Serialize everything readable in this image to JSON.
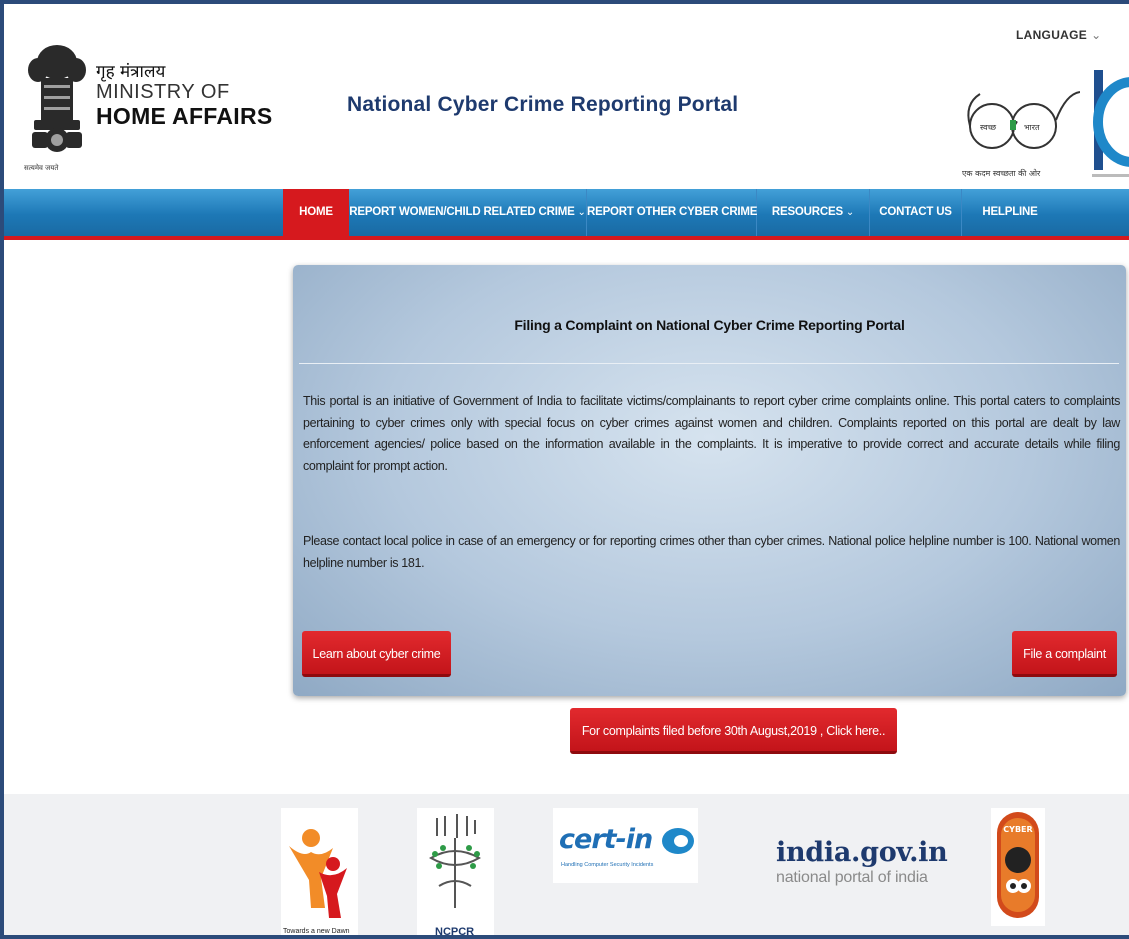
{
  "header": {
    "ministry_hindi": "गृह मंत्रालय",
    "ministry_line1": "MINISTRY OF",
    "ministry_line2": "HOME AFFAIRS",
    "emblem_caption": "सत्यमेव जयते",
    "portal_title": "National Cyber Crime Reporting Portal",
    "language_label": "LANGUAGE",
    "swachh_left": "स्वच्छ",
    "swachh_right": "भारत",
    "swachh_caption": "एक कदम स्वच्छता की ओर"
  },
  "nav": {
    "items": [
      {
        "label": "HOME",
        "active": true,
        "dropdown": false
      },
      {
        "label": "REPORT WOMEN/CHILD RELATED CRIME",
        "active": false,
        "dropdown": true
      },
      {
        "label": "REPORT OTHER CYBER CRIME",
        "active": false,
        "dropdown": false
      },
      {
        "label": "RESOURCES",
        "active": false,
        "dropdown": true
      },
      {
        "label": "CONTACT US",
        "active": false,
        "dropdown": false
      },
      {
        "label": "HELPLINE",
        "active": false,
        "dropdown": false
      }
    ]
  },
  "main": {
    "title": "Filing a Complaint on National Cyber Crime Reporting Portal",
    "paragraph1": "This portal is an initiative of Government of India to facilitate victims/complainants to report cyber crime complaints online. This portal caters to complaints pertaining to cyber crimes only with special focus on cyber crimes against women and children. Complaints reported on this portal are dealt by law enforcement agencies/ police based on the information available in the complaints. It is imperative to provide correct and accurate details while filing complaint for prompt action.",
    "paragraph2": "Please contact local police in case of an emergency or for reporting crimes other than cyber crimes. National police helpline number is 100. National women helpline number is 181.",
    "learn_button": "Learn about cyber crime",
    "file_button": "File a complaint"
  },
  "old_complaints_button": "For complaints filed before 30th August,2019 , Click here..",
  "footer": {
    "logo1_caption": "Towards a new Dawn",
    "logo2_caption": "NCPCR",
    "certin_text": "cert-in",
    "certin_caption": "Handling Computer Security Incidents",
    "india_gov_main": "india.gov.in",
    "india_gov_sub": "national portal of india",
    "cyber_badge_text": "CYBER"
  },
  "colors": {
    "nav_blue": "#1d78b6",
    "accent_red": "#d6191e",
    "title_navy": "#1e3a6e"
  }
}
